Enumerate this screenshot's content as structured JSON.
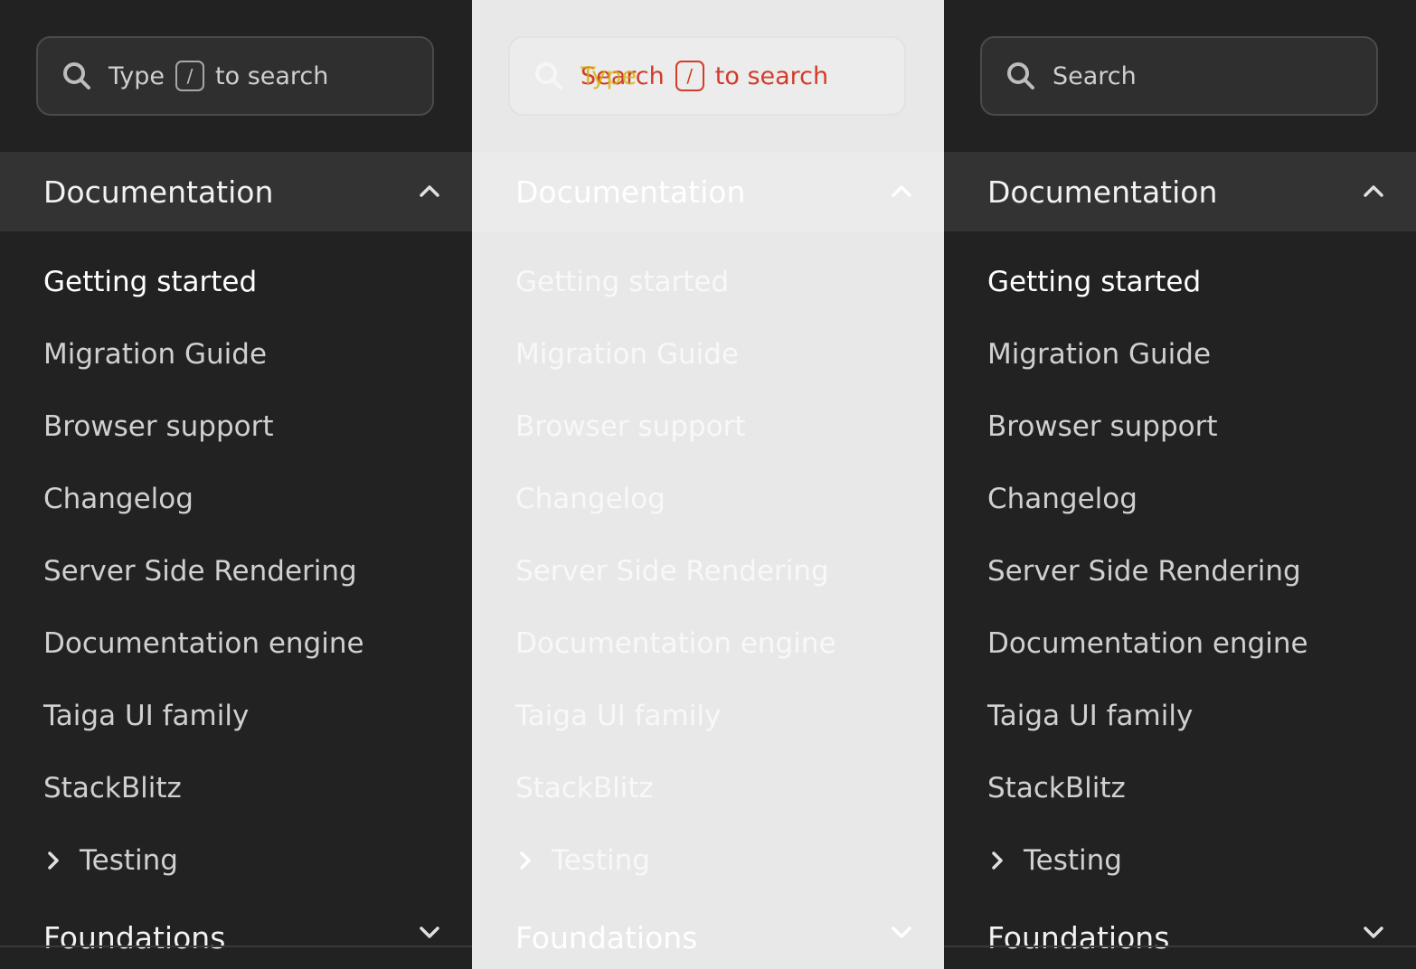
{
  "colors": {
    "dark_bg": "#222222",
    "dark_header_bg": "#333333",
    "light_bg": "#e8e8e8",
    "highlight_red": "#d23c2b",
    "highlight_yellow": "#d5b300"
  },
  "panels": [
    {
      "theme": "dark",
      "search": {
        "icon": "search-icon",
        "prefix": "Type",
        "key": "/",
        "suffix": "to search"
      },
      "section": {
        "label": "Documentation",
        "icon": "chevron-up-icon"
      },
      "items": [
        {
          "label": "Getting started"
        },
        {
          "label": "Migration Guide"
        },
        {
          "label": "Browser support"
        },
        {
          "label": "Changelog"
        },
        {
          "label": "Server Side Rendering"
        },
        {
          "label": "Documentation engine"
        },
        {
          "label": "Taiga UI family"
        },
        {
          "label": "StackBlitz"
        },
        {
          "label": "Testing",
          "icon": "chevron-right-icon"
        }
      ],
      "footer_section": {
        "label": "Foundations",
        "icon": "chevron-down-icon"
      }
    },
    {
      "theme": "light",
      "search": {
        "icon": "search-icon",
        "prefix": "Search",
        "ghost": "Type",
        "key": "/",
        "suffix": "to search"
      },
      "section": {
        "label": "Documentation",
        "icon": "chevron-up-icon"
      },
      "items": [
        {
          "label": "Getting started"
        },
        {
          "label": "Migration Guide"
        },
        {
          "label": "Browser support"
        },
        {
          "label": "Changelog"
        },
        {
          "label": "Server Side Rendering"
        },
        {
          "label": "Documentation engine"
        },
        {
          "label": "Taiga UI family"
        },
        {
          "label": "StackBlitz"
        },
        {
          "label": "Testing",
          "icon": "chevron-right-icon"
        }
      ],
      "footer_section": {
        "label": "Foundations",
        "icon": "chevron-down-icon"
      }
    },
    {
      "theme": "dark",
      "search": {
        "icon": "search-icon",
        "placeholder": "Search"
      },
      "section": {
        "label": "Documentation",
        "icon": "chevron-up-icon"
      },
      "items": [
        {
          "label": "Getting started"
        },
        {
          "label": "Migration Guide"
        },
        {
          "label": "Browser support"
        },
        {
          "label": "Changelog"
        },
        {
          "label": "Server Side Rendering"
        },
        {
          "label": "Documentation engine"
        },
        {
          "label": "Taiga UI family"
        },
        {
          "label": "StackBlitz"
        },
        {
          "label": "Testing",
          "icon": "chevron-right-icon"
        }
      ],
      "footer_section": {
        "label": "Foundations",
        "icon": "chevron-down-icon"
      }
    }
  ]
}
